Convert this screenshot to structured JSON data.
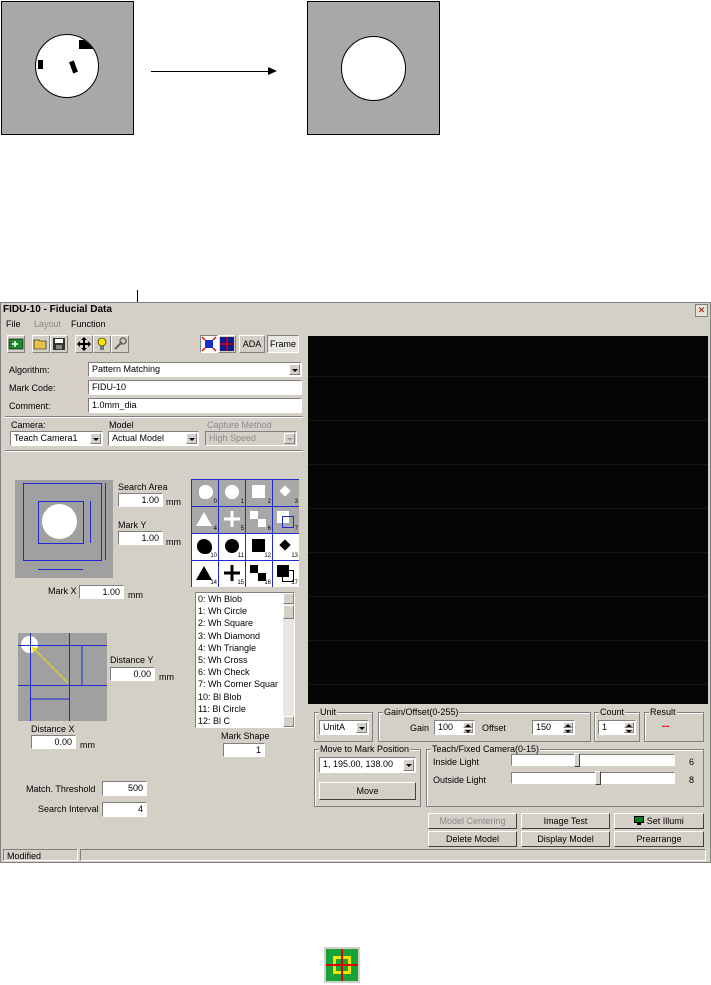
{
  "window": {
    "title": "FIDU-10 - Fiducial Data",
    "close_glyph": "✕"
  },
  "menu": {
    "file": "File",
    "layout": "Layout",
    "function": "Function"
  },
  "toolbar": {
    "ada_label": "ADA",
    "frame_label": "Frame"
  },
  "form": {
    "algorithm_label": "Algorithm:",
    "algorithm_value": "Pattern Matching",
    "mark_code_label": "Mark Code:",
    "mark_code_value": "FIDU-10",
    "comment_label": "Comment:",
    "comment_value": "1.0mm_dia"
  },
  "camera": {
    "camera_label": "Camera:",
    "camera_value": "Teach Camera1",
    "model_label": "Model",
    "model_value": "Actual Model",
    "capture_label": "Capture Method",
    "capture_value": "High Speed"
  },
  "search": {
    "search_area_label": "Search Area",
    "search_area_value": "1.00",
    "mark_y_label": "Mark Y",
    "mark_y_value": "1.00",
    "mark_x_label": "Mark X",
    "mark_x_value": "1.00",
    "unit_mm": "mm",
    "distance_y_label": "Distance Y",
    "distance_y_value": "0.00",
    "distance_x_label": "Distance X",
    "distance_x_value": "0.00",
    "match_threshold_label": "Match. Threshold",
    "match_threshold_value": "500",
    "search_interval_label": "Search Interval",
    "search_interval_value": "4"
  },
  "shapes": {
    "numbers": [
      "0",
      "1",
      "2",
      "3",
      "4",
      "5",
      "6",
      "7",
      "10",
      "11",
      "12",
      "13",
      "14",
      "15",
      "16",
      "17"
    ],
    "list": [
      "0: Wh Blob",
      "1: Wh Circle",
      "2: Wh Square",
      "3: Wh Diamond",
      "4: Wh Triangle",
      "5: Wh Cross",
      "6: Wh Check",
      "7: Wh Corner Squar",
      "10: Bl Blob",
      "11: Bl Circle",
      "12: Bl C"
    ],
    "mark_shape_label": "Mark Shape",
    "mark_shape_value": "1"
  },
  "controls": {
    "unit_label": "Unit",
    "unit_value": "UnitA",
    "gain_offset_label": "Gain/Offset(0-255)",
    "gain_label": "Gain",
    "gain_value": "100",
    "offset_label": "Offset",
    "offset_value": "150",
    "count_label": "Count",
    "count_value": "1",
    "result_label": "Result",
    "result_value": "--",
    "move_to_label": "Move to Mark Position",
    "move_to_value": "1, 195.00, 138.00",
    "move_button": "Move",
    "teach_label": "Teach/Fixed Camera(0-15)",
    "inside_light_label": "Inside Light",
    "inside_light_value": "6",
    "inside_light_level": 0.4,
    "outside_light_label": "Outside Light",
    "outside_light_value": "8",
    "outside_light_level": 0.53
  },
  "buttons": {
    "model_centering": "Model Centering",
    "image_test": "Image Test",
    "set_illumi": "Set Illumi",
    "delete_model": "Delete Model",
    "display_model": "Display Model",
    "prearrange": "Prearrange"
  },
  "status": {
    "text": "Modified"
  },
  "colors": {
    "window_bg": "#d4d0c8",
    "accent_blue": "#1f2bd0",
    "result_red": "#e00000",
    "camera_bg": "#050505"
  }
}
